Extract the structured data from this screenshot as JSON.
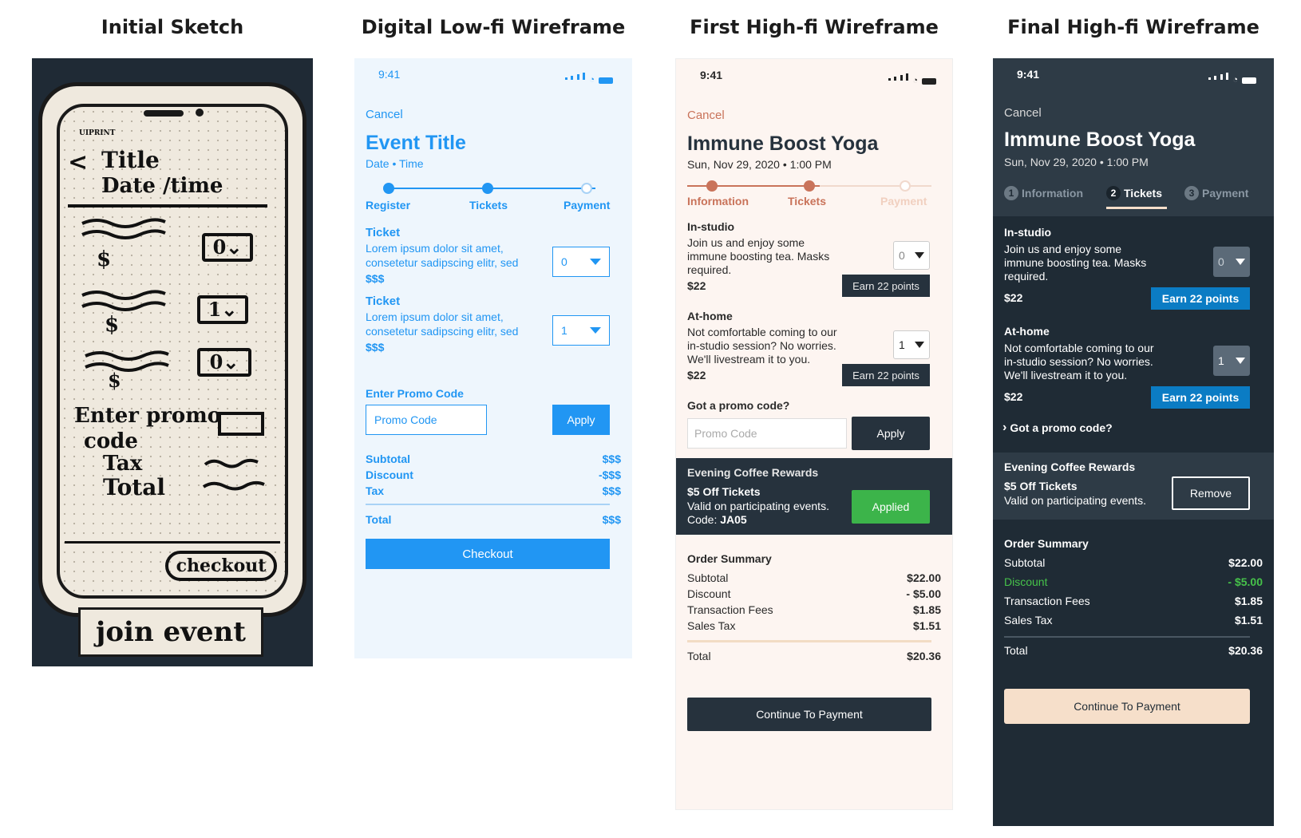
{
  "headings": {
    "sketch": "Initial Sketch",
    "lofi": "Digital Low-fi Wireframe",
    "hifi1": "First High-fi Wireframe",
    "hifi2": "Final High-fi Wireframe"
  },
  "sketch": {
    "brand": "UIPRINT",
    "back": "<",
    "title": "Title",
    "datetime": "Date /time",
    "dollar": "$",
    "qty": [
      "0",
      "1",
      "0"
    ],
    "promo1": "Enter promo",
    "promo2": "code",
    "tax": "Tax",
    "total": "Total",
    "checkout": "checkout",
    "join": "join event"
  },
  "lofi": {
    "time": "9:41",
    "cancel": "Cancel",
    "title": "Event Title",
    "date": "Date • Time",
    "steps": [
      "Register",
      "Tickets",
      "Payment"
    ],
    "tickets": [
      {
        "name": "Ticket",
        "desc1": "Lorem ipsum dolor sit amet,",
        "desc2": "consetetur sadipscing elitr, sed",
        "price": "$$$",
        "qty": "0"
      },
      {
        "name": "Ticket",
        "desc1": "Lorem ipsum dolor sit amet,",
        "desc2": "consetetur sadipscing elitr, sed",
        "price": "$$$",
        "qty": "1"
      }
    ],
    "promo_label": "Enter Promo Code",
    "promo_placeholder": "Promo Code",
    "apply": "Apply",
    "summary": [
      {
        "label": "Subtotal",
        "value": "$$$"
      },
      {
        "label": "Discount",
        "value": "-$$$"
      },
      {
        "label": "Tax",
        "value": "$$$"
      }
    ],
    "total_label": "Total",
    "total_value": "$$$",
    "checkout": "Checkout"
  },
  "hifi1": {
    "time": "9:41",
    "cancel": "Cancel",
    "title": "Immune Boost Yoga",
    "date": "Sun, Nov 29, 2020 • 1:00 PM",
    "steps": [
      "Information",
      "Tickets",
      "Payment"
    ],
    "tickets": [
      {
        "name": "In-studio",
        "desc1": "Join us and enjoy some",
        "desc2": "immune boosting tea. Masks",
        "desc3": "required.",
        "price": "$22",
        "qty": "0",
        "points": "Earn 22 points"
      },
      {
        "name": "At-home",
        "desc1": "Not comfortable coming to our",
        "desc2": "in-studio session? No worries.",
        "desc3": "We'll livestream it to you.",
        "price": "$22",
        "qty": "1",
        "points": "Earn 22 points"
      }
    ],
    "promo_label": "Got a promo code?",
    "promo_placeholder": "Promo Code",
    "apply": "Apply",
    "reward_title": "Evening Coffee Rewards",
    "reward_name": "$5 Off Tickets",
    "reward_desc": "Valid on participating events.",
    "reward_code_label": "Code: ",
    "reward_code": "JA05",
    "applied": "Applied",
    "order_summary": "Order Summary",
    "summary": [
      {
        "label": "Subtotal",
        "value": "$22.00"
      },
      {
        "label": "Discount",
        "value": "- $5.00"
      },
      {
        "label": "Transaction Fees",
        "value": "$1.85"
      },
      {
        "label": "Sales Tax",
        "value": "$1.51"
      }
    ],
    "total_label": "Total",
    "total_value": "$20.36",
    "continue": "Continue To Payment"
  },
  "hifi2": {
    "time": "9:41",
    "cancel": "Cancel",
    "title": "Immune Boost Yoga",
    "date": "Sun, Nov 29, 2020 • 1:00 PM",
    "tabs": [
      {
        "num": "1",
        "label": "Information"
      },
      {
        "num": "2",
        "label": "Tickets"
      },
      {
        "num": "3",
        "label": "Payment"
      }
    ],
    "tickets": [
      {
        "name": "In-studio",
        "desc1": "Join us and enjoy some",
        "desc2": "immune boosting tea. Masks",
        "desc3": "required.",
        "price": "$22",
        "qty": "0",
        "points": "Earn 22 points"
      },
      {
        "name": "At-home",
        "desc1": "Not comfortable coming to our",
        "desc2": "in-studio session? No worries.",
        "desc3": "We'll livestream it to you.",
        "price": "$22",
        "qty": "1",
        "points": "Earn 22 points"
      }
    ],
    "promo_label": "Got a promo code?",
    "reward_title": "Evening Coffee Rewards",
    "reward_name": "$5 Off Tickets",
    "reward_desc": "Valid on participating events.",
    "remove": "Remove",
    "order_summary": "Order Summary",
    "summary": [
      {
        "label": "Subtotal",
        "value": "$22.00"
      },
      {
        "label": "Discount",
        "value": "- $5.00"
      },
      {
        "label": "Transaction Fees",
        "value": "$1.85"
      },
      {
        "label": "Sales Tax",
        "value": "$1.51"
      }
    ],
    "total_label": "Total",
    "total_value": "$20.36",
    "continue": "Continue To Payment"
  },
  "colors": {
    "lofi_blue": "#2196f3",
    "hifi1_accent": "#c9735a",
    "hifi1_dark": "#26323d",
    "applied_green": "#3cb44a",
    "hifi2_bg": "#1f2b35",
    "earn_blue": "#0b7cc4",
    "discount_green": "#46c24a",
    "continue_peach": "#f6dfca"
  }
}
